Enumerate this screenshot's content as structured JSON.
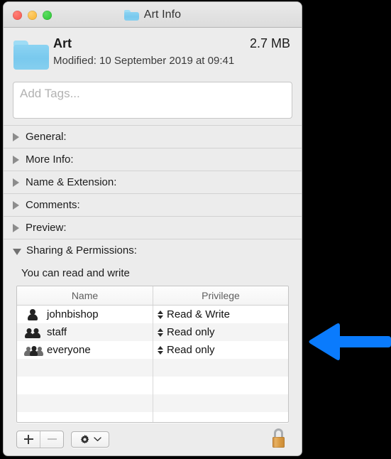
{
  "window": {
    "title": "Art Info",
    "title_icon": "folder-icon",
    "traffic_lights": [
      {
        "name": "close",
        "color": "#f5534a"
      },
      {
        "name": "minimize",
        "color": "#f7b12c"
      },
      {
        "name": "zoom",
        "color": "#26c330"
      }
    ]
  },
  "header": {
    "icon": "folder-icon",
    "name": "Art",
    "size": "2.7 MB",
    "modified": "Modified: 10 September 2019 at 09:41"
  },
  "tags": {
    "placeholder": "Add Tags...",
    "value": ""
  },
  "sections": [
    {
      "label": "General:",
      "expanded": false
    },
    {
      "label": "More Info:",
      "expanded": false
    },
    {
      "label": "Name & Extension:",
      "expanded": false
    },
    {
      "label": "Comments:",
      "expanded": false
    },
    {
      "label": "Preview:",
      "expanded": false
    },
    {
      "label": "Sharing & Permissions:",
      "expanded": true
    }
  ],
  "sharing": {
    "note": "You can read and write",
    "columns": [
      "Name",
      "Privilege"
    ],
    "rows": [
      {
        "icon": "single-user-icon",
        "name": "johnbishop",
        "privilege": "Read & Write"
      },
      {
        "icon": "group-users-icon",
        "name": "staff",
        "privilege": "Read only"
      },
      {
        "icon": "everyone-users-icon",
        "name": "everyone",
        "privilege": "Read only"
      }
    ]
  },
  "toolbar": {
    "add_label": "+",
    "remove_label": "–",
    "remove_enabled": false,
    "action_icon": "gear-icon",
    "action_chevron": "chevron-down-icon",
    "lock_icon": "unlocked-padlock-icon",
    "lock_state": "unlocked"
  },
  "annotation": {
    "arrow_icon": "left-arrow-icon",
    "arrow_color": "#0a7bfd",
    "direction": "left"
  }
}
